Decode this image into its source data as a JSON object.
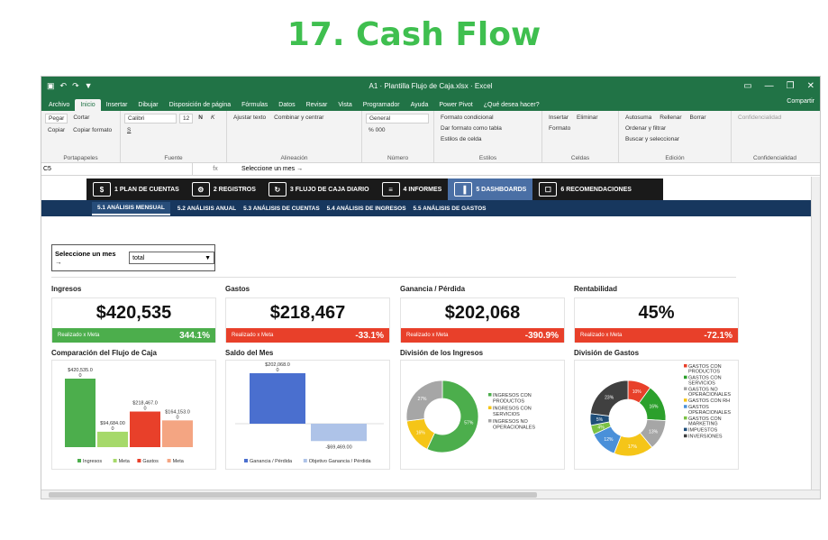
{
  "page_title": "17. Cash Flow",
  "window": {
    "doc_title": "A1 · Plantilla Flujo de Caja.xlsx · Excel",
    "quick_access": [
      "▣",
      "↶",
      "↷",
      "▼"
    ],
    "controls": [
      "▭",
      "—",
      "❐",
      "✕"
    ]
  },
  "ribbon_tabs": [
    "Archivo",
    "Inicio",
    "Insertar",
    "Dibujar",
    "Disposición de página",
    "Fórmulas",
    "Datos",
    "Revisar",
    "Vista",
    "Programador",
    "Ayuda",
    "Power Pivot",
    "¿Qué desea hacer?"
  ],
  "share_label": "Compartir",
  "ribbon_groups": [
    {
      "name": "Portapapeles",
      "items": [
        "Pegar",
        "Cortar",
        "Copiar",
        "Copiar formato"
      ]
    },
    {
      "name": "Fuente",
      "items": [
        "Calibri",
        "12",
        "N",
        "K",
        "S"
      ]
    },
    {
      "name": "Alineación",
      "items": [
        "Ajustar texto",
        "Combinar y centrar"
      ]
    },
    {
      "name": "Número",
      "items": [
        "General",
        "% 000"
      ]
    },
    {
      "name": "Estilos",
      "items": [
        "Formato condicional",
        "Dar formato como tabla",
        "Estilos de celda"
      ]
    },
    {
      "name": "Celdas",
      "items": [
        "Insertar",
        "Eliminar",
        "Formato"
      ]
    },
    {
      "name": "Edición",
      "items": [
        "Autosuma",
        "Rellenar",
        "Borrar",
        "Ordenar y filtrar",
        "Buscar y seleccionar"
      ]
    },
    {
      "name": "Confidencialidad",
      "items": [
        "Confidencialidad"
      ]
    }
  ],
  "formula_bar": {
    "name_box": "C5",
    "fx": "fx",
    "formula": "Seleccione un mes →"
  },
  "nav_main": [
    {
      "icon": "$",
      "label": "1 PLAN DE CUENTAS"
    },
    {
      "icon": "⚙",
      "label": "2 REGISTROS"
    },
    {
      "icon": "↻",
      "label": "3 FLUJO DE CAJA DIARIO"
    },
    {
      "icon": "≡",
      "label": "4 INFORMES"
    },
    {
      "icon": "▐",
      "label": "5 DASHBOARDS"
    },
    {
      "icon": "☐",
      "label": "6 RECOMENDACIONES"
    }
  ],
  "nav_sub": [
    "5.1 ANÁLISIS MENSUAL",
    "5.2 ANÁLISIS ANUAL",
    "5.3 ANÁLISIS DE CUENTAS",
    "5.4 ANÁLISIS DE INGRESOS",
    "5.5 ANÁLISIS DE GASTOS"
  ],
  "selector": {
    "label": "Seleccione un mes →",
    "value": "total",
    "arrow": "▼"
  },
  "kpis": [
    {
      "title": "Ingresos",
      "value": "$420,535",
      "bar_label": "Realizado x Meta",
      "pct": "344.1%",
      "color": "#4cae4c"
    },
    {
      "title": "Gastos",
      "value": "$218,467",
      "bar_label": "Realizado x Meta",
      "pct": "-33.1%",
      "color": "#e8402a"
    },
    {
      "title": "Ganancia / Pérdida",
      "value": "$202,068",
      "bar_label": "Realizado x Meta",
      "pct": "-390.9%",
      "color": "#e8402a"
    },
    {
      "title": "Rentabilidad",
      "value": "45%",
      "bar_label": "Realizado x Meta",
      "pct": "-72.1%",
      "color": "#e8402a"
    }
  ],
  "chart_titles": [
    "Comparación del Flujo de Caja",
    "Saldo del Mes",
    "División de los Ingresos",
    "División de Gastos"
  ],
  "chart_data": [
    {
      "type": "bar",
      "title": "Comparación del Flujo de Caja",
      "categories": [
        "Ingresos",
        "Meta",
        "Gastos",
        "Meta"
      ],
      "values": [
        420535,
        94684,
        218467,
        164153
      ],
      "labels": [
        "$420,535.0",
        "$94,684.00",
        "$218,467.0",
        "$164,153.0"
      ],
      "colors": [
        "#4cae4c",
        "#a6d96a",
        "#e8402a",
        "#f4a582"
      ]
    },
    {
      "type": "bar",
      "title": "Saldo del Mes",
      "categories": [
        "Ganancia / Pérdida",
        "Objetivo Ganancia / Pérdida"
      ],
      "values": [
        202068,
        -69469
      ],
      "labels": [
        "$202,068.0",
        "-$69,469.00"
      ],
      "colors": [
        "#4a6fcf",
        "#aec3e8"
      ]
    },
    {
      "type": "pie",
      "title": "División de los Ingresos",
      "slices": [
        {
          "name": "INGRESOS CON PRODUCTOS",
          "value": 57,
          "label": "57%",
          "color": "#4cae4c"
        },
        {
          "name": "INGRESOS CON SERVICIOS",
          "value": 16,
          "label": "16%",
          "color": "#f5c518"
        },
        {
          "name": "INGRESOS NO OPERACIONALES",
          "value": 27,
          "label": "27%",
          "color": "#a6a6a6"
        }
      ]
    },
    {
      "type": "pie",
      "title": "División de Gastos",
      "slices": [
        {
          "name": "GASTOS CON PRODUCTOS",
          "value": 10,
          "label": "10%",
          "color": "#e8402a"
        },
        {
          "name": "GASTOS CON SERVICIOS",
          "value": 16,
          "label": "16%",
          "color": "#2ca02c"
        },
        {
          "name": "GASTOS NO OPERACIONALES",
          "value": 13,
          "label": "13%",
          "color": "#a6a6a6"
        },
        {
          "name": "GASTOS CON RH",
          "value": 17,
          "label": "17%",
          "color": "#f5c518"
        },
        {
          "name": "GASTOS OPERACIONALES",
          "value": 12,
          "label": "12%",
          "color": "#4a90d9"
        },
        {
          "name": "GASTOS CON MARKETING",
          "value": 4,
          "label": "4%",
          "color": "#7ac143"
        },
        {
          "name": "IMPUESTOS",
          "value": 5,
          "label": "5%",
          "color": "#1f4e79"
        },
        {
          "name": "INVERSIONES",
          "value": 23,
          "label": "23%",
          "color": "#404040"
        }
      ]
    }
  ]
}
